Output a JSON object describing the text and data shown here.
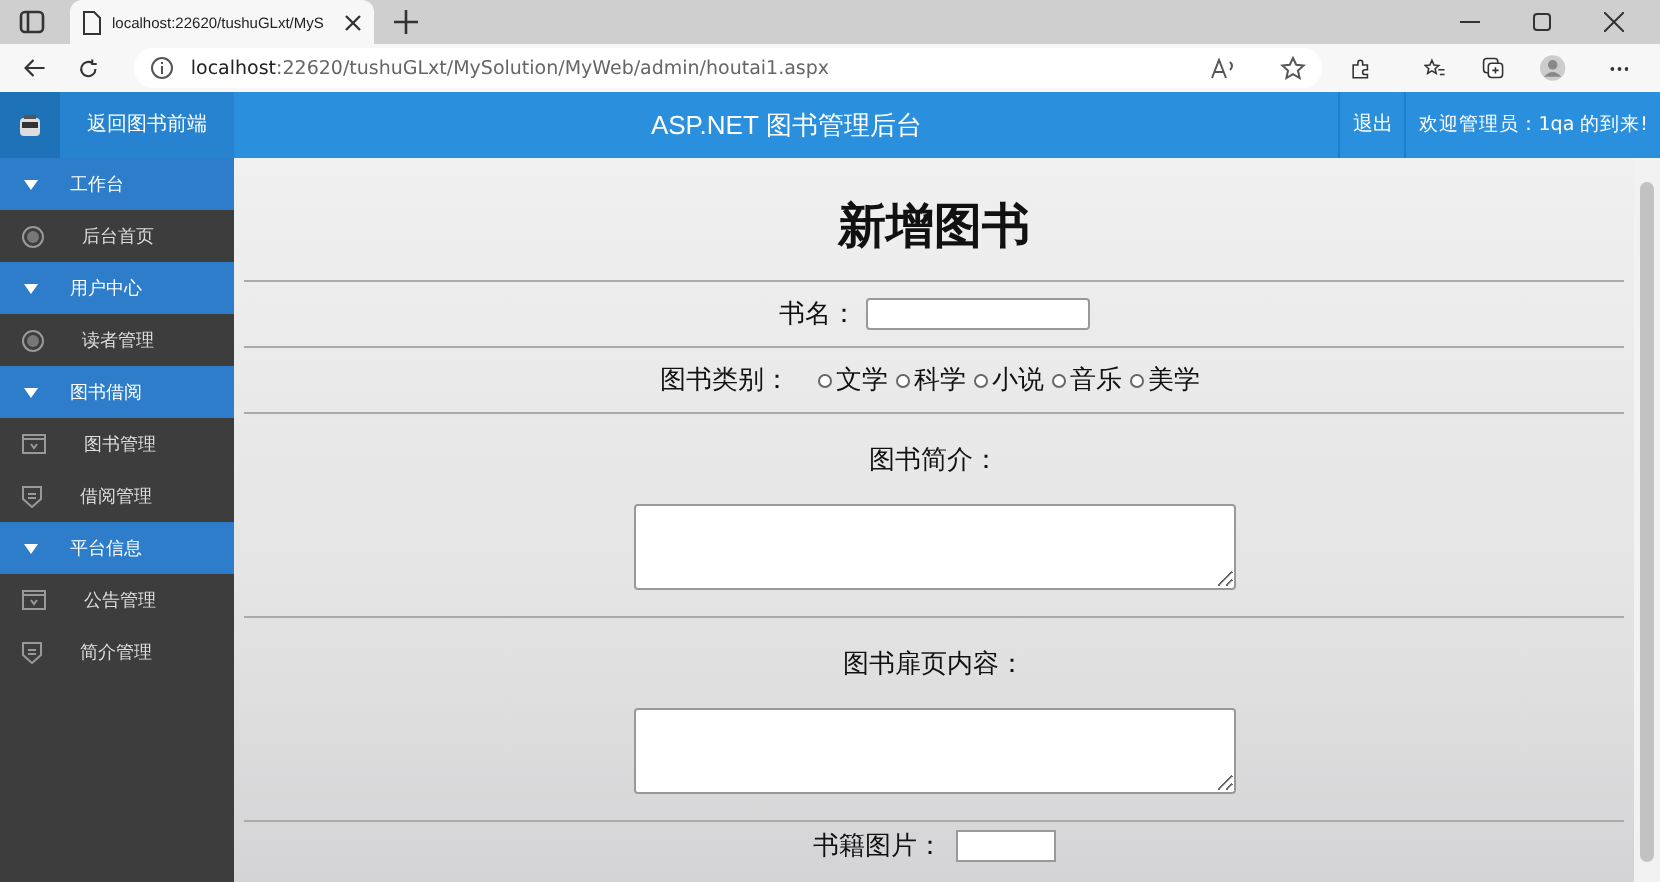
{
  "browser": {
    "tab_title": "localhost:22620/tushuGLxt/MyS",
    "url_host": "localhost",
    "url_rest": ":22620/tushuGLxt/MySolution/MyWeb/admin/houtai1.aspx"
  },
  "header": {
    "back_link": "返回图书前端",
    "title": "ASP.NET 图书管理后台",
    "logout": "退出",
    "welcome": "欢迎管理员：1qa 的到来!"
  },
  "sidebar": {
    "groups": [
      {
        "label": "工作台",
        "expanded": true,
        "children": [
          {
            "label": "后台首页",
            "kind": "circle"
          }
        ]
      },
      {
        "label": "用户中心",
        "expanded": true,
        "children": [
          {
            "label": "读者管理",
            "kind": "circle"
          }
        ]
      },
      {
        "label": "图书借阅",
        "expanded": true,
        "children": [
          {
            "label": "图书管理",
            "kind": "screen"
          },
          {
            "label": "借阅管理",
            "kind": "shield"
          }
        ]
      },
      {
        "label": "平台信息",
        "expanded": true,
        "children": [
          {
            "label": "公告管理",
            "kind": "screen"
          },
          {
            "label": "简介管理",
            "kind": "shield"
          }
        ]
      }
    ]
  },
  "form": {
    "title": "新增图书",
    "name_label": "书名：",
    "category_label": "图书类别：",
    "categories": [
      {
        "label": "文学",
        "selected": false
      },
      {
        "label": "科学",
        "selected": false
      },
      {
        "label": "小说",
        "selected": false
      },
      {
        "label": "音乐",
        "selected": false
      },
      {
        "label": "美学",
        "selected": false
      }
    ],
    "intro_label": "图书简介：",
    "content_label": "图书扉页内容：",
    "image_label": "书籍图片："
  }
}
